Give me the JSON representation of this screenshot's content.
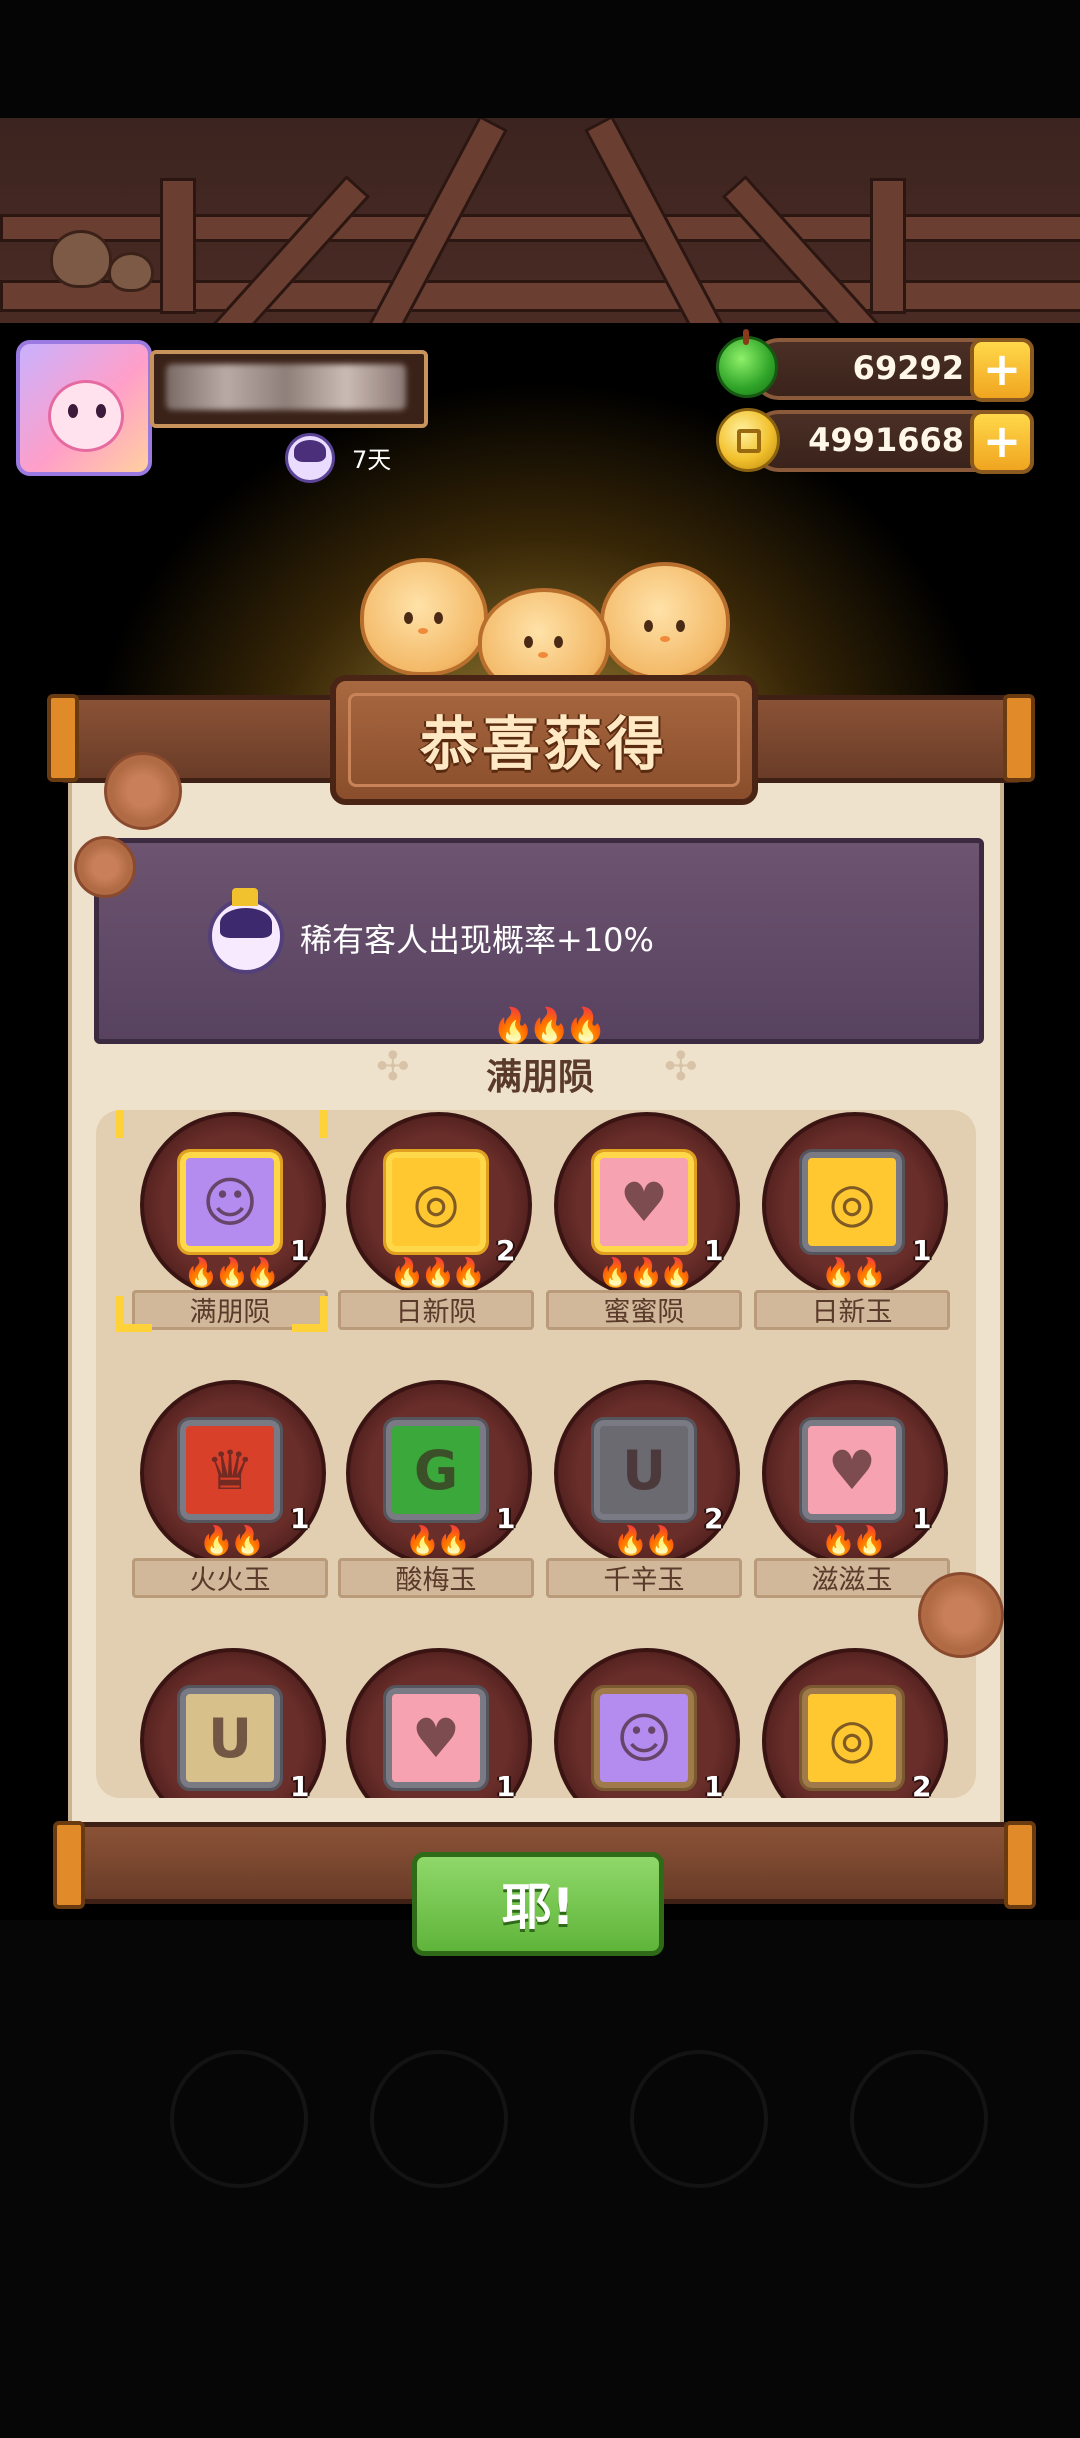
{
  "header": {
    "days_label": "7天"
  },
  "currency": {
    "gems": "69292",
    "coins": "4991668",
    "plus_label": "+"
  },
  "dialog": {
    "title": "恭喜获得",
    "bonus_text": "稀有客人出现概率+10%",
    "featured_item": "满朋陨",
    "featured_flames": "🔥🔥🔥",
    "confirm_label": "耶!"
  },
  "items": [
    {
      "name": "满朋陨",
      "count": "1",
      "flames": "🔥🔥🔥",
      "icon": "cloud-face-icon",
      "glyph": "☺",
      "bg": "#ffd84a",
      "inner": "#b48cf0",
      "border": "#e0a020"
    },
    {
      "name": "日新陨",
      "count": "2",
      "flames": "🔥🔥🔥",
      "icon": "fish-icon",
      "glyph": "◎",
      "bg": "#ffd84a",
      "inner": "#ffc830",
      "border": "#e0a020"
    },
    {
      "name": "蜜蜜陨",
      "count": "1",
      "flames": "🔥🔥🔥",
      "icon": "heart-icon",
      "glyph": "♥",
      "bg": "#ffd84a",
      "inner": "#f7a2b0",
      "border": "#e0a020"
    },
    {
      "name": "日新玉",
      "count": "1",
      "flames": "🔥🔥",
      "icon": "fish-icon",
      "glyph": "◎",
      "bg": "#7a7a84",
      "inner": "#ffc830",
      "border": "#55555e"
    },
    {
      "name": "火火玉",
      "count": "1",
      "flames": "🔥🔥",
      "icon": "fire-crown-icon",
      "glyph": "♛",
      "bg": "#7a7a84",
      "inner": "#d9402a",
      "border": "#55555e"
    },
    {
      "name": "酸梅玉",
      "count": "1",
      "flames": "🔥🔥",
      "icon": "swirl-icon",
      "glyph": "G",
      "bg": "#7a7a84",
      "inner": "#3aa83a",
      "border": "#55555e"
    },
    {
      "name": "千辛玉",
      "count": "2",
      "flames": "🔥🔥",
      "icon": "bowl-icon",
      "glyph": "U",
      "bg": "#7a7a84",
      "inner": "#6a6a70",
      "border": "#55555e"
    },
    {
      "name": "滋滋玉",
      "count": "1",
      "flames": "🔥🔥",
      "icon": "heart-icon",
      "glyph": "♥",
      "bg": "#7a7a84",
      "inner": "#f7a2b0",
      "border": "#55555e"
    },
    {
      "name": "",
      "count": "1",
      "flames": "",
      "icon": "bowl-icon",
      "glyph": "U",
      "bg": "#7a7a84",
      "inner": "#d8c08a",
      "border": "#55555e"
    },
    {
      "name": "",
      "count": "1",
      "flames": "",
      "icon": "heart-icon",
      "glyph": "♥",
      "bg": "#7a7a84",
      "inner": "#f7a2b0",
      "border": "#55555e"
    },
    {
      "name": "",
      "count": "1",
      "flames": "",
      "icon": "cloud-face-icon",
      "glyph": "☺",
      "bg": "#a07a4a",
      "inner": "#b48cf0",
      "border": "#7a5a30"
    },
    {
      "name": "",
      "count": "2",
      "flames": "",
      "icon": "fish-icon",
      "glyph": "◎",
      "bg": "#a07a4a",
      "inner": "#ffc830",
      "border": "#7a5a30"
    }
  ]
}
